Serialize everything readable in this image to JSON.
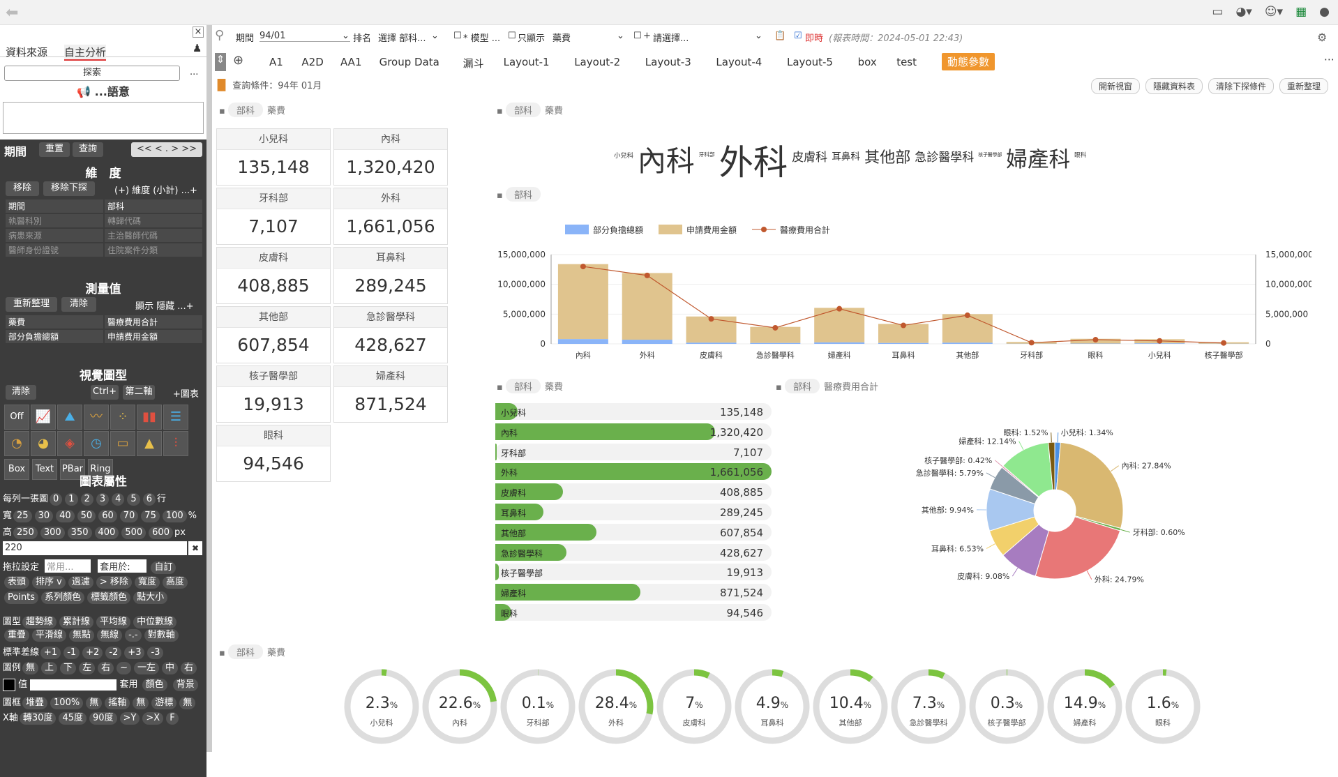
{
  "left": {
    "tab1": "資料來源",
    "tab2": "自主分析",
    "search": "探索",
    "semantic": "...語意",
    "period": "期間",
    "reset": "重置",
    "query": "查詢",
    "navbtns": "<< < . > >>",
    "dimension": "維　度",
    "remove": "移除",
    "remove_drill": "移除下探",
    "add_dim": "(+) 維度 (小計) ...+",
    "dims": [
      [
        "期間",
        "部科"
      ],
      [
        "執醫科別",
        "轉歸代碼"
      ],
      [
        "病患來源",
        "主治醫師代碼"
      ],
      [
        "醫師身份證號",
        "住院案件分類"
      ]
    ],
    "measure": "測量值",
    "reorganize": "重新整理",
    "clear": "清除",
    "show_hide": "顯示 隱藏 ...+",
    "measures": [
      [
        "藥費",
        "醫療費用合計"
      ],
      [
        "部分負擔總額",
        "申請費用金額"
      ]
    ],
    "visual": "視覺圖型",
    "vclear": "清除",
    "ctrl": "Ctrl+",
    "axis2": "第二軸",
    "addchart": "+圖表",
    "vtext": [
      "Off",
      "Box",
      "Text",
      "PBar",
      "Ring"
    ],
    "chartprop": "圖表屬性",
    "row1": "每列一張圖",
    "nums": [
      "0",
      "1",
      "2",
      "3",
      "4",
      "5",
      "6"
    ],
    "row1end": "行",
    "wlabel": "寬",
    "wvals": [
      "25",
      "30",
      "40",
      "50",
      "60",
      "70",
      "75",
      "100"
    ],
    "wunit": "%",
    "hlabel": "高",
    "hvals": [
      "250",
      "300",
      "350",
      "400",
      "500",
      "600"
    ],
    "hunit": "px",
    "hinput": "220",
    "drag": "拖拉設定",
    "common": "常用...",
    "apply": "套用於:",
    "custom": "自訂",
    "r1": [
      "表頭",
      "排序 v",
      "過濾",
      "> 移除",
      "寬度",
      "高度"
    ],
    "r2": [
      "Points",
      "系列顏色",
      "標籤顏色",
      "點大小"
    ],
    "r3": [
      "圖型",
      "趨勢線",
      "累計線",
      "平均線",
      "中位數線"
    ],
    "r4": [
      "重疊",
      "平滑線",
      "無點",
      "無線",
      "-.-",
      "對數軸"
    ],
    "r5": [
      "標準差線",
      "+1",
      "-1",
      "+2",
      "-2",
      "+3",
      "-3"
    ],
    "r6": [
      "圖例",
      "無",
      "上",
      "下",
      "左",
      "右",
      "~",
      "一左",
      "中",
      "右"
    ],
    "r7a": "值",
    "r7b": "套用",
    "r7c": "顏色",
    "r7d": "背景",
    "r8": [
      "圖框",
      "堆疊",
      "100%",
      "無",
      "搖軸",
      "無",
      "游標",
      "無"
    ],
    "r9": [
      "X軸",
      "轉30度",
      "45度",
      "90度",
      ">Y",
      ">X",
      "F"
    ]
  },
  "filter": {
    "period_label": "期間",
    "period": "94/01",
    "rank_label": "排名",
    "rank": "選擇 部科...",
    "model": "* 模型 ...",
    "only": "只顯示",
    "only_val": "藥費",
    "plus": "+",
    "plus_val": "請選擇...",
    "live": "即時",
    "report_time": "(報表時間：2024-05-01 22:43)"
  },
  "tabs": [
    "A1",
    "A2D",
    "AA1",
    "Group Data",
    "漏斗",
    "Layout-1",
    "Layout-2",
    "Layout-3",
    "Layout-4",
    "Layout-5",
    "box",
    "test",
    "動態參數"
  ],
  "query_line": "查詢條件：94年 01月",
  "rbtns": [
    "開新視窗",
    "隱藏資料表",
    "清除下探條件",
    "重新整理"
  ],
  "p1": {
    "t1": "部科",
    "t2": "藥費"
  },
  "p2": {
    "t1": "部科",
    "t2": "藥費"
  },
  "p3": {
    "t1": "部科"
  },
  "p4": {
    "t1": "部科",
    "t2": "藥費"
  },
  "p5": {
    "t1": "部科",
    "t2": "醫療費用合計"
  },
  "p6": {
    "t1": "部科",
    "t2": "藥費"
  },
  "cards": [
    [
      "小兒科",
      "135,148"
    ],
    [
      "內科",
      "1,320,420"
    ],
    [
      "牙科部",
      "7,107"
    ],
    [
      "外科",
      "1,661,056"
    ],
    [
      "皮膚科",
      "408,885"
    ],
    [
      "耳鼻科",
      "289,245"
    ],
    [
      "其他部",
      "607,854"
    ],
    [
      "急診醫學科",
      "428,627"
    ],
    [
      "核子醫學部",
      "19,913"
    ],
    [
      "婦產科",
      "871,524"
    ],
    [
      "眼科",
      "94,546"
    ]
  ],
  "wordcloud": [
    [
      "小兒科",
      11
    ],
    [
      "內科",
      48
    ],
    [
      "牙科部",
      9
    ],
    [
      "外科",
      58
    ],
    [
      "皮膚科",
      20
    ],
    [
      "耳鼻科",
      16
    ],
    [
      "其他部",
      26
    ],
    [
      "急診醫學科",
      20
    ],
    [
      "核子醫學部",
      8
    ],
    [
      "婦產科",
      36
    ],
    [
      "眼科",
      10
    ]
  ],
  "chart_data": [
    {
      "type": "bar",
      "stacked": true,
      "categories": [
        "內科",
        "外科",
        "皮膚科",
        "急診醫學科",
        "婦產科",
        "耳鼻科",
        "其他部",
        "牙科部",
        "眼科",
        "小兒科",
        "核子醫學部"
      ],
      "series": [
        {
          "name": "部分負擔總額",
          "type": "bar",
          "values": [
            800000,
            700000,
            200000,
            150000,
            250000,
            150000,
            200000,
            20000,
            50000,
            80000,
            20000
          ]
        },
        {
          "name": "申請費用金額",
          "type": "bar",
          "values": [
            12600000,
            11200000,
            4400000,
            2700000,
            5800000,
            3200000,
            4800000,
            300000,
            800000,
            700000,
            250000
          ]
        },
        {
          "name": "醫療費用合計",
          "type": "line",
          "values": [
            13000000,
            11500000,
            4200000,
            2700000,
            5900000,
            3100000,
            4800000,
            200000,
            700000,
            500000,
            150000
          ]
        }
      ],
      "ylim": [
        0,
        15000000
      ],
      "yticks": [
        "15,000,000",
        "10,000,000",
        "5,000,000",
        "0"
      ],
      "grid": true,
      "legend": "top-left",
      "colors": [
        "#8ab4f8",
        "#e0c48e",
        "#c0582e"
      ]
    },
    {
      "type": "bar",
      "orientation": "horizontal",
      "categories": [
        "小兒科",
        "內科",
        "牙科部",
        "外科",
        "皮膚科",
        "耳鼻科",
        "其他部",
        "急診醫學科",
        "核子醫學部",
        "婦產科",
        "眼科"
      ],
      "values": [
        135148,
        1320420,
        7107,
        1661056,
        408885,
        289245,
        607854,
        428627,
        19913,
        871524,
        94546
      ],
      "color": "#6ab04c"
    },
    {
      "type": "pie",
      "donut": true,
      "labels": [
        "小兒科",
        "內科",
        "牙科部",
        "外科",
        "皮膚科",
        "耳鼻科",
        "其他部",
        "急診醫學科",
        "核子醫學部",
        "婦產科",
        "眼科"
      ],
      "values": [
        1.34,
        27.84,
        0.6,
        24.79,
        9.08,
        6.53,
        9.94,
        5.79,
        0.42,
        12.14,
        1.52
      ],
      "display": [
        "小兒科: 1.34%",
        "內科: 27.84%",
        "牙科部: 0.60%",
        "外科: 24.79%",
        "皮膚科: 9.08%",
        "耳鼻科: 6.53%",
        "其他部: 9.94%",
        "急診醫學科: 5.79%",
        "核子醫學部: 0.42%",
        "婦產科: 12.14%",
        "眼科: 1.52%"
      ],
      "colors": [
        "#4a90e2",
        "#d9b871",
        "#6ab04c",
        "#e87777",
        "#a77cc0",
        "#f2d06b",
        "#a9c8f0",
        "#8a9aa8",
        "#e29cb3",
        "#8fe88f",
        "#7a5a10"
      ]
    },
    {
      "type": "ring",
      "labels": [
        "小兒科",
        "內科",
        "牙科部",
        "外科",
        "皮膚科",
        "耳鼻科",
        "其他部",
        "急診醫學科",
        "核子醫學部",
        "婦產科",
        "眼科"
      ],
      "values": [
        2.3,
        22.6,
        0.1,
        28.4,
        7,
        4.9,
        10.4,
        7.3,
        0.3,
        14.9,
        1.6
      ],
      "unit": "%",
      "color": "#7cc440"
    }
  ]
}
